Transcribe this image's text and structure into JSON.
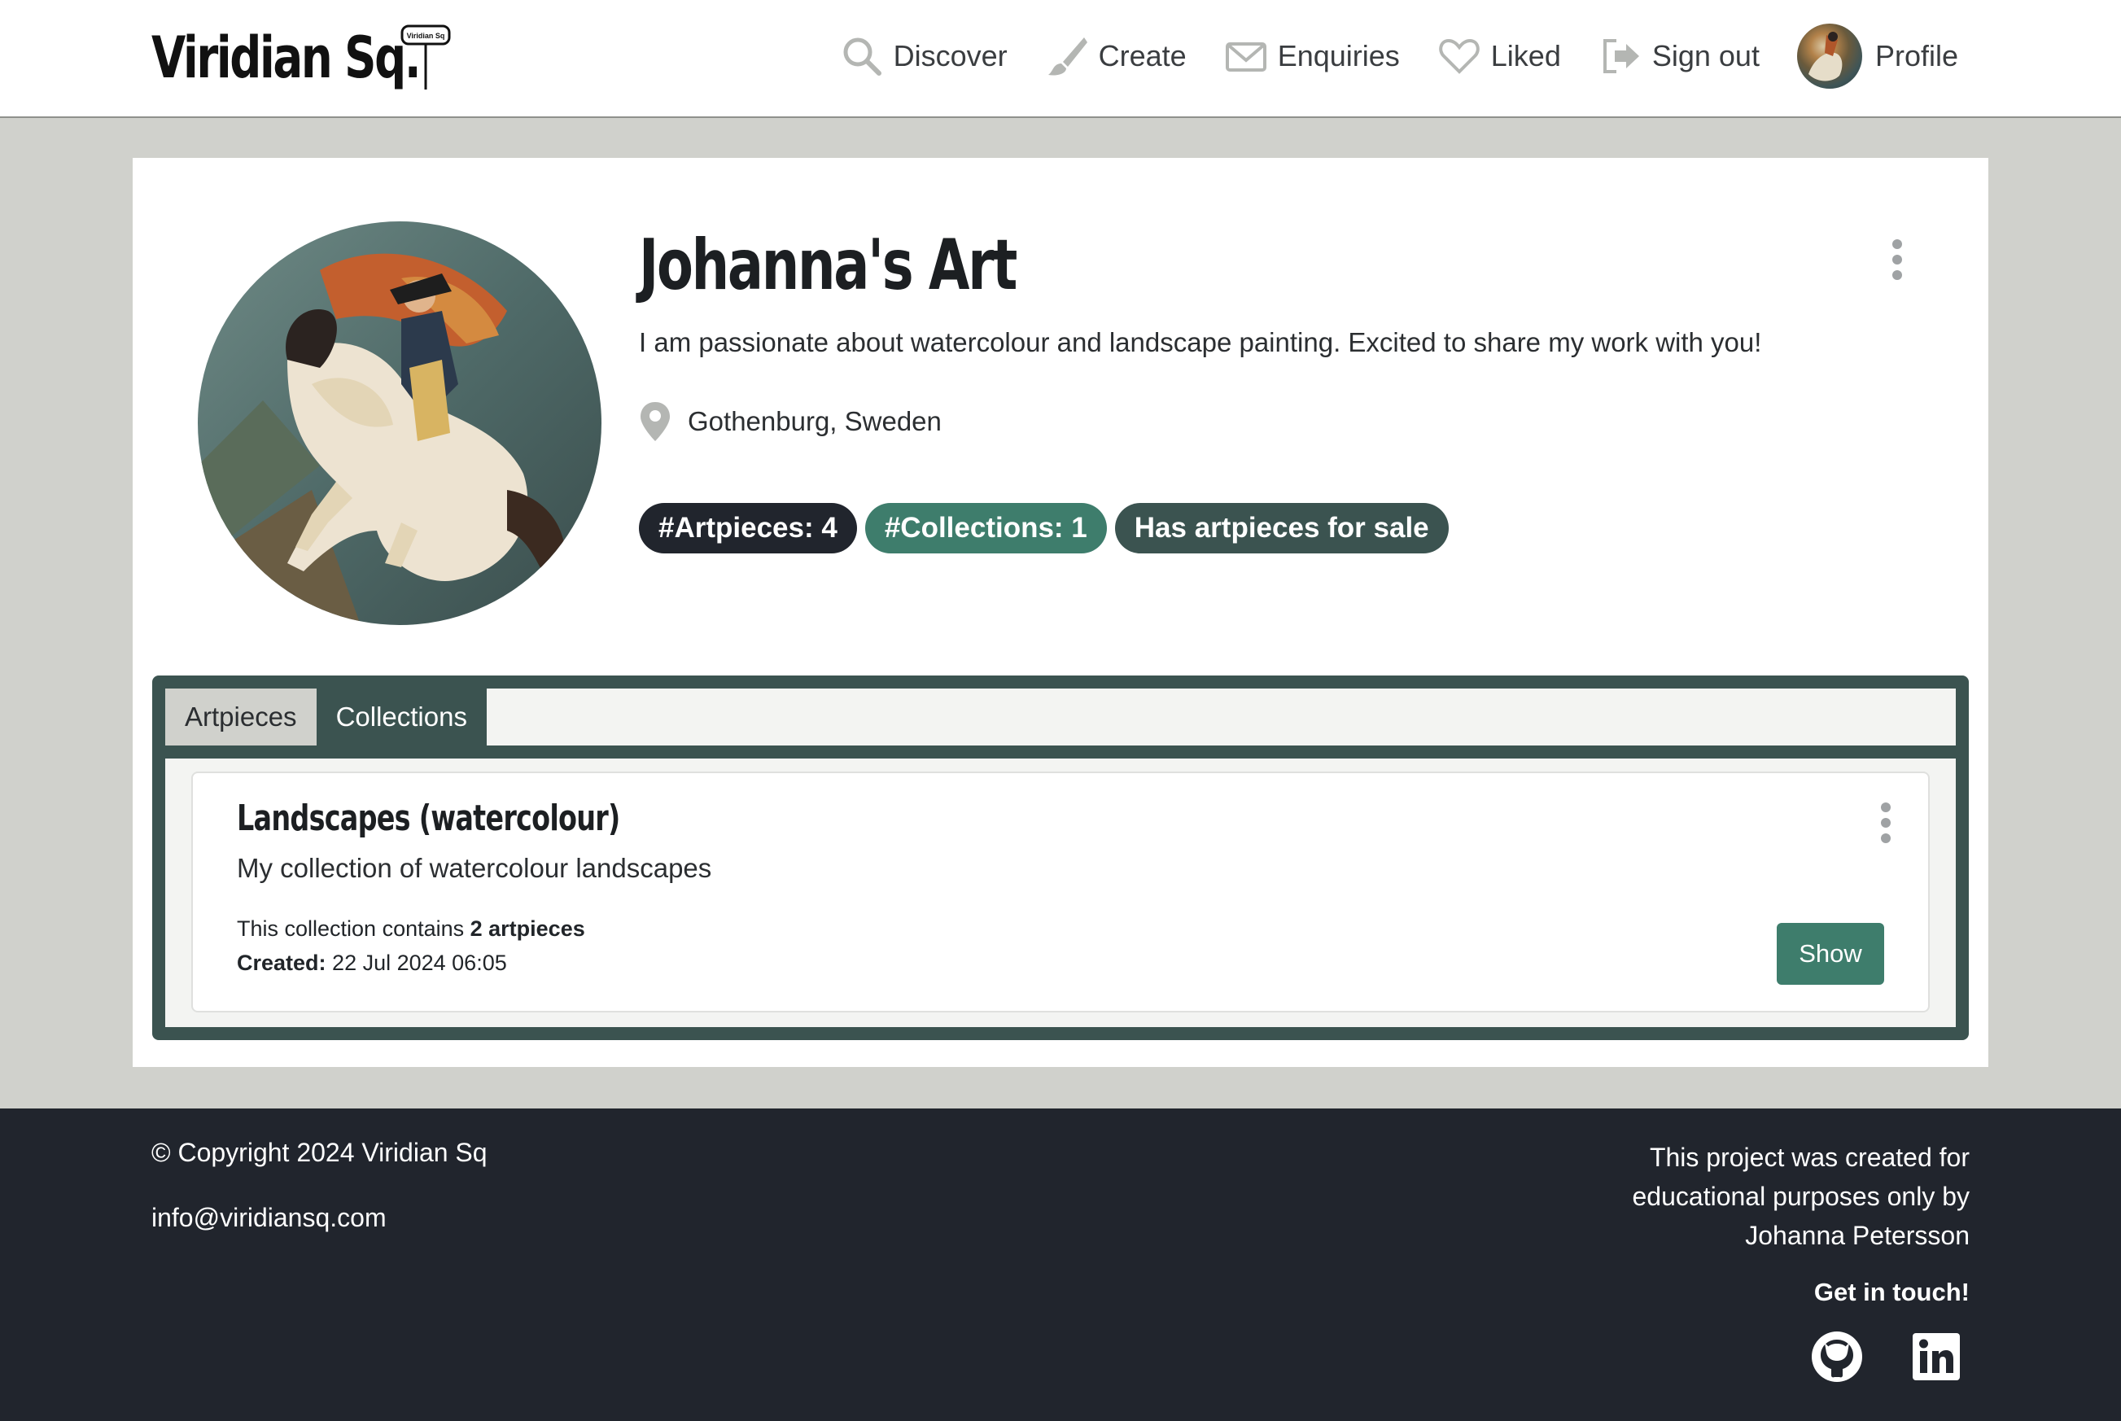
{
  "navbar": {
    "brand": "Viridian Sq.",
    "brand_sign": "Viridian Sq",
    "links": [
      {
        "label": "Discover",
        "icon": "search-icon"
      },
      {
        "label": "Create",
        "icon": "paintbrush-icon"
      },
      {
        "label": "Enquiries",
        "icon": "envelope-icon"
      },
      {
        "label": "Liked",
        "icon": "heart-icon"
      },
      {
        "label": "Sign out",
        "icon": "sign-out-icon"
      },
      {
        "label": "Profile",
        "icon": "avatar"
      }
    ]
  },
  "profile": {
    "title": "Johanna's Art",
    "bio": "I am passionate about watercolour and landscape painting. Excited to share my work with you!",
    "location": "Gothenburg, Sweden",
    "badges": [
      {
        "label": "#Artpieces: 4",
        "color": "#21252d"
      },
      {
        "label": "#Collections: 1",
        "color": "#3e7d6c"
      },
      {
        "label": "Has artpieces for sale",
        "color": "#3b5350"
      }
    ]
  },
  "tabs": {
    "items": [
      {
        "label": "Artpieces",
        "active": false
      },
      {
        "label": "Collections",
        "active": true
      }
    ]
  },
  "collection": {
    "title": "Landscapes (watercolour)",
    "description": "My collection of watercolour landscapes",
    "count_prefix": "This collection contains ",
    "count_value": "2 artpieces",
    "created_label": "Created:",
    "created_value": "22 Jul 2024 06:05",
    "show_label": "Show"
  },
  "footer": {
    "copyright": "© Copyright 2024 Viridian Sq",
    "email": "info@viridiansq.com",
    "note": "This project was created for educational purposes only by Johanna Petersson",
    "get_in_touch": "Get in touch!"
  },
  "colors": {
    "page_bg": "#d0d1cc",
    "dark_green": "#3b5350",
    "accent_green": "#3e7d6c",
    "footer_bg": "#21252d"
  }
}
